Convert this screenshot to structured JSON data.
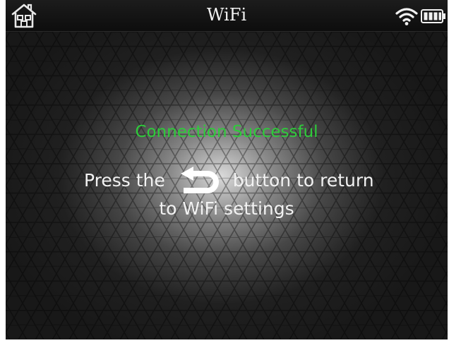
{
  "status_bar": {
    "title": "WiFi",
    "home_icon": "home-icon",
    "wifi_icon": "wifi-icon",
    "battery_icon": "battery-icon"
  },
  "main": {
    "success_message": "Connection Successful",
    "instruction_before_icon": "Press the",
    "return_icon": "return-arrow-icon",
    "instruction_after_icon": "button to return",
    "instruction_line2": "to WiFi settings"
  },
  "colors": {
    "success": "#2ecc3a",
    "text": "#f2f2f2",
    "background": "#181818"
  }
}
